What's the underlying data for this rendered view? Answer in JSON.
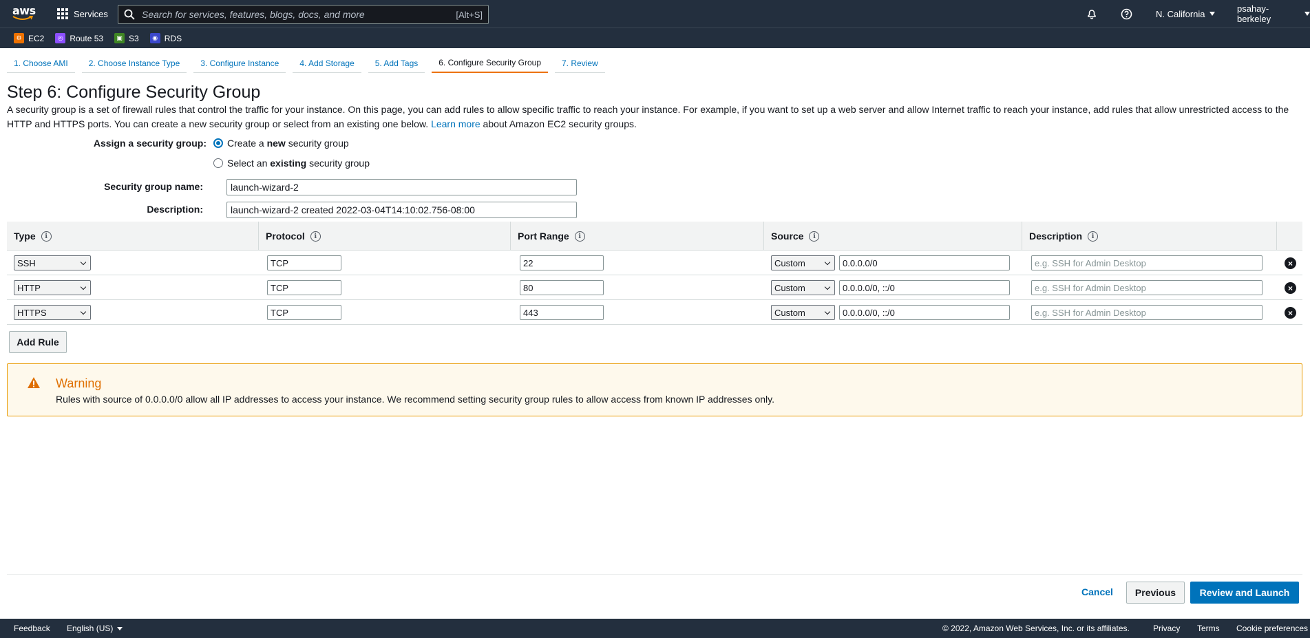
{
  "nav": {
    "logo_text": "aws",
    "services_label": "Services",
    "search_placeholder": "Search for services, features, blogs, docs, and more",
    "search_shortcut": "[Alt+S]",
    "region": "N. California",
    "account": "psahay-berkeley"
  },
  "favorites": [
    {
      "label": "EC2",
      "color": "#ed7100"
    },
    {
      "label": "Route 53",
      "color": "#8c4fff"
    },
    {
      "label": "S3",
      "color": "#3f8624"
    },
    {
      "label": "RDS",
      "color": "#3b48cc"
    }
  ],
  "wizard": {
    "tabs": [
      "1. Choose AMI",
      "2. Choose Instance Type",
      "3. Configure Instance",
      "4. Add Storage",
      "5. Add Tags",
      "6. Configure Security Group",
      "7. Review"
    ],
    "active_tab": "6. Configure Security Group"
  },
  "page": {
    "title": "Step 6: Configure Security Group",
    "intro_text": "A security group is a set of firewall rules that control the traffic for your instance. On this page, you can add rules to allow specific traffic to reach your instance. For example, if you want to set up a web server and allow Internet traffic to reach your instance, add rules that allow unrestricted access to the HTTP and HTTPS ports. You can create a new security group or select from an existing one below.",
    "learn_more": "Learn more",
    "intro_suffix": "about Amazon EC2 security groups."
  },
  "form": {
    "assign_label": "Assign a security group:",
    "option_new_prefix": "Create a",
    "option_new_bold": "new",
    "option_new_suffix": "security group",
    "option_existing_prefix": "Select an",
    "option_existing_bold": "existing",
    "option_existing_suffix": "security group",
    "name_label": "Security group name:",
    "name_value": "launch-wizard-2",
    "desc_label": "Description:",
    "desc_value": "launch-wizard-2 created 2022-03-04T14:10:02.756-08:00"
  },
  "rules": {
    "headers": [
      "Type",
      "Protocol",
      "Port Range",
      "Source",
      "Description"
    ],
    "info_glyph": "i",
    "rows": [
      {
        "type": "SSH",
        "protocol": "TCP",
        "port": "22",
        "source_type": "Custom",
        "source": "0.0.0.0/0",
        "description_placeholder": "e.g. SSH for Admin Desktop"
      },
      {
        "type": "HTTP",
        "protocol": "TCP",
        "port": "80",
        "source_type": "Custom",
        "source": "0.0.0.0/0, ::/0",
        "description_placeholder": "e.g. SSH for Admin Desktop"
      },
      {
        "type": "HTTPS",
        "protocol": "TCP",
        "port": "443",
        "source_type": "Custom",
        "source": "0.0.0.0/0, ::/0",
        "description_placeholder": "e.g. SSH for Admin Desktop"
      }
    ],
    "add_rule_label": "Add Rule",
    "remove_glyph": "×"
  },
  "warning": {
    "title": "Warning",
    "text": "Rules with source of 0.0.0.0/0 allow all IP addresses to access your instance. We recommend setting security group rules to allow access from known IP addresses only."
  },
  "actions": {
    "cancel": "Cancel",
    "previous": "Previous",
    "review_launch": "Review and Launch"
  },
  "footer": {
    "feedback": "Feedback",
    "language": "English (US)",
    "copyright": "© 2022, Amazon Web Services, Inc. or its affiliates.",
    "privacy": "Privacy",
    "terms": "Terms",
    "cookies": "Cookie preferences"
  }
}
